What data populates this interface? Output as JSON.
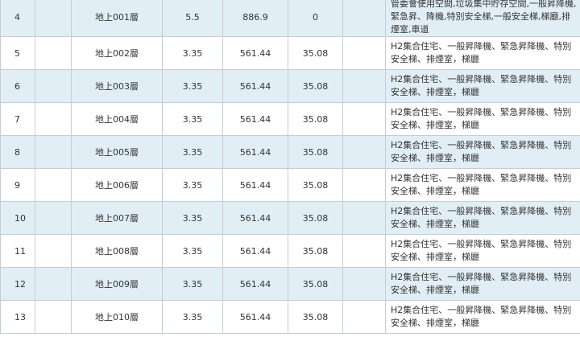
{
  "rows": [
    {
      "no": "4",
      "floor": "地上001層",
      "height": "5.5",
      "area": "886.9",
      "mezzanine": "0",
      "use": "管委會使用空間,垃圾集中貯存空間,一般昇降機,緊急昇、降機,特別安全梯,一般安全梯,梯廳,排煙室,車道"
    },
    {
      "no": "5",
      "floor": "地上002層",
      "height": "3.35",
      "area": "561.44",
      "mezzanine": "35.08",
      "use": "H2集合住宅、一般昇降機、緊急昇降機、特別安全梯、排煙室，梯廳"
    },
    {
      "no": "6",
      "floor": "地上003層",
      "height": "3.35",
      "area": "561.44",
      "mezzanine": "35.08",
      "use": "H2集合住宅、一般昇降機、緊急昇降機、特別安全梯、排煙室，梯廳"
    },
    {
      "no": "7",
      "floor": "地上004層",
      "height": "3.35",
      "area": "561.44",
      "mezzanine": "35.08",
      "use": "H2集合住宅、一般昇降機、緊急昇降機、特別安全梯、排煙室，梯廳"
    },
    {
      "no": "8",
      "floor": "地上005層",
      "height": "3.35",
      "area": "561.44",
      "mezzanine": "35.08",
      "use": "H2集合住宅、一般昇降機、緊急昇降機、特別安全梯、排煙室，梯廳"
    },
    {
      "no": "9",
      "floor": "地上006層",
      "height": "3.35",
      "area": "561.44",
      "mezzanine": "35.08",
      "use": "H2集合住宅、一般昇降機、緊急昇降機、特別安全梯、排煙室，梯廳"
    },
    {
      "no": "10",
      "floor": "地上007層",
      "height": "3.35",
      "area": "561.44",
      "mezzanine": "35.08",
      "use": "H2集合住宅、一般昇降機、緊急昇降機、特別安全梯、排煙室，梯廳"
    },
    {
      "no": "11",
      "floor": "地上008層",
      "height": "3.35",
      "area": "561.44",
      "mezzanine": "35.08",
      "use": "H2集合住宅、一般昇降機、緊急昇降機、特別安全梯、排煙室，梯廳"
    },
    {
      "no": "12",
      "floor": "地上009層",
      "height": "3.35",
      "area": "561.44",
      "mezzanine": "35.08",
      "use": "H2集合住宅、一般昇降機、緊急昇降機、特別安全梯、排煙室，梯廳"
    },
    {
      "no": "13",
      "floor": "地上010層",
      "height": "3.35",
      "area": "561.44",
      "mezzanine": "35.08",
      "use": "H2集合住宅、一般昇降機、緊急昇降機、特別安全梯、排煙室，梯廳"
    }
  ]
}
